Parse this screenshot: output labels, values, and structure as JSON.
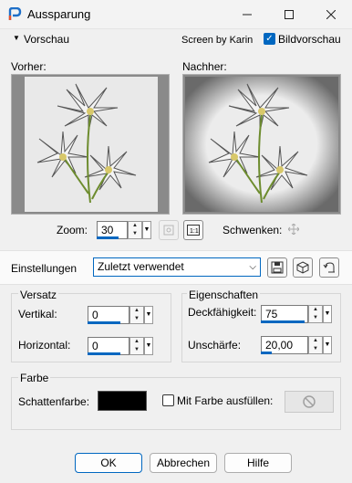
{
  "window": {
    "title": "Aussparung"
  },
  "preview": {
    "toggle_label": "Vorschau",
    "credit": "Screen by Karin",
    "image_preview_label": "Bildvorschau",
    "image_preview_checked": true,
    "before_label": "Vorher:",
    "after_label": "Nachher:",
    "zoom_label": "Zoom:",
    "zoom_value": "30",
    "pan_label": "Schwenken:"
  },
  "settings": {
    "label": "Einstellungen",
    "preset_value": "Zuletzt verwendet"
  },
  "offset": {
    "group_label": "Versatz",
    "vertical_label": "Vertikal:",
    "vertical_value": "0",
    "horizontal_label": "Horizontal:",
    "horizontal_value": "0"
  },
  "properties": {
    "group_label": "Eigenschaften",
    "opacity_label": "Deckfähigkeit:",
    "opacity_value": "75",
    "blur_label": "Unschärfe:",
    "blur_value": "20,00"
  },
  "color": {
    "group_label": "Farbe",
    "shadow_color_label": "Schattenfarbe:",
    "shadow_color": "#000000",
    "fill_label": "Mit Farbe ausfüllen:",
    "fill_checked": false
  },
  "buttons": {
    "ok": "OK",
    "cancel": "Abbrechen",
    "help": "Hilfe"
  },
  "colors": {
    "accent": "#0067c0",
    "preview_bg": "#8a8a8a"
  }
}
